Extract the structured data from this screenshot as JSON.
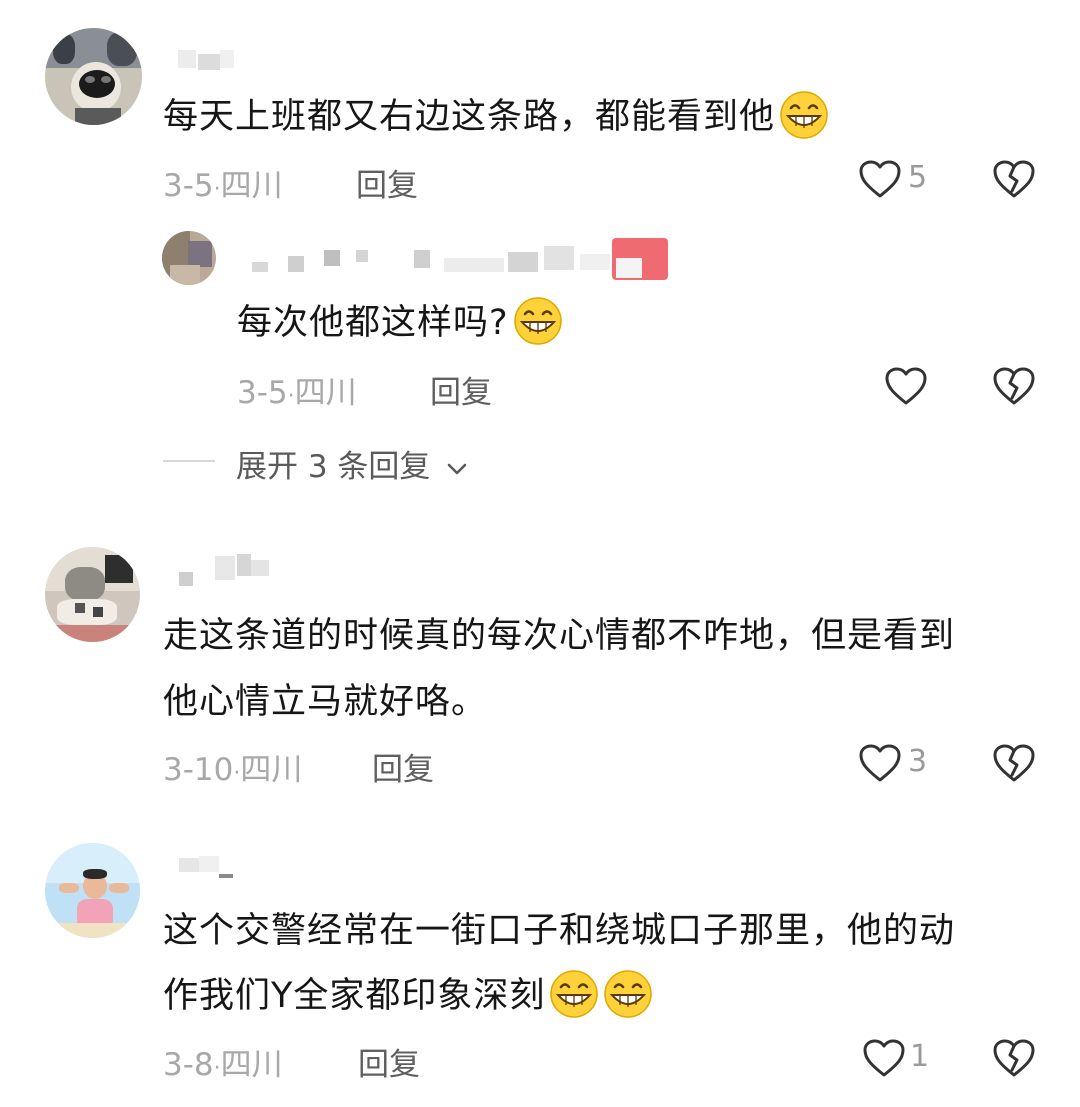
{
  "comments": [
    {
      "text": "每天上班都又右边这条路，都能看到他",
      "emoji": "grin-emoji",
      "date": "3-5",
      "location": "四川",
      "reply_label": "回复",
      "like_count": "5",
      "reply": {
        "text": "每次他都这样吗?",
        "emoji": "grin-emoji",
        "date": "3-5",
        "location": "四川",
        "reply_label": "回复"
      },
      "expand_label": "展开 3 条回复"
    },
    {
      "text_line1": "走这条道的时候真的每次心情都不咋地，但是看到",
      "text_line2": "他心情立马就好咯。",
      "date": "3-10",
      "location": "四川",
      "reply_label": "回复",
      "like_count": "3"
    },
    {
      "text_line1": "这个交警经常在一街口子和绕城口子那里，他的动",
      "text_line2": "作我们Y全家都印象深刻",
      "emoji": "grin-emoji",
      "date": "3-8",
      "location": "四川",
      "reply_label": "回复",
      "like_count": "1"
    }
  ],
  "colors": {
    "emoji_face": "#ffd23a",
    "text": "#161616",
    "meta": "#a8a8a8",
    "reply": "#5f5f5f"
  }
}
